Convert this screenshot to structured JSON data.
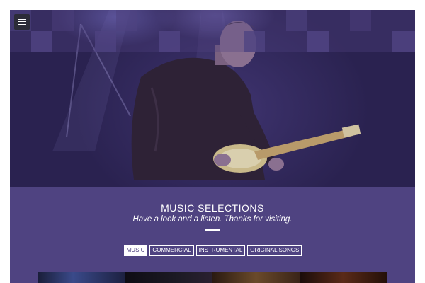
{
  "header": {
    "menu_icon": "hamburger-menu-icon"
  },
  "section": {
    "title": "MUSIC SELECTIONS",
    "subtitle": "Have a look and a listen. Thanks for visiting."
  },
  "filters": [
    {
      "label": "MUSIC",
      "active": true
    },
    {
      "label": "COMMERCIAL",
      "active": false
    },
    {
      "label": "INSTRUMENTAL",
      "active": false
    },
    {
      "label": "ORIGINAL SONGS",
      "active": false
    }
  ],
  "colors": {
    "accent": "#4f4381",
    "text": "#ffffff"
  }
}
